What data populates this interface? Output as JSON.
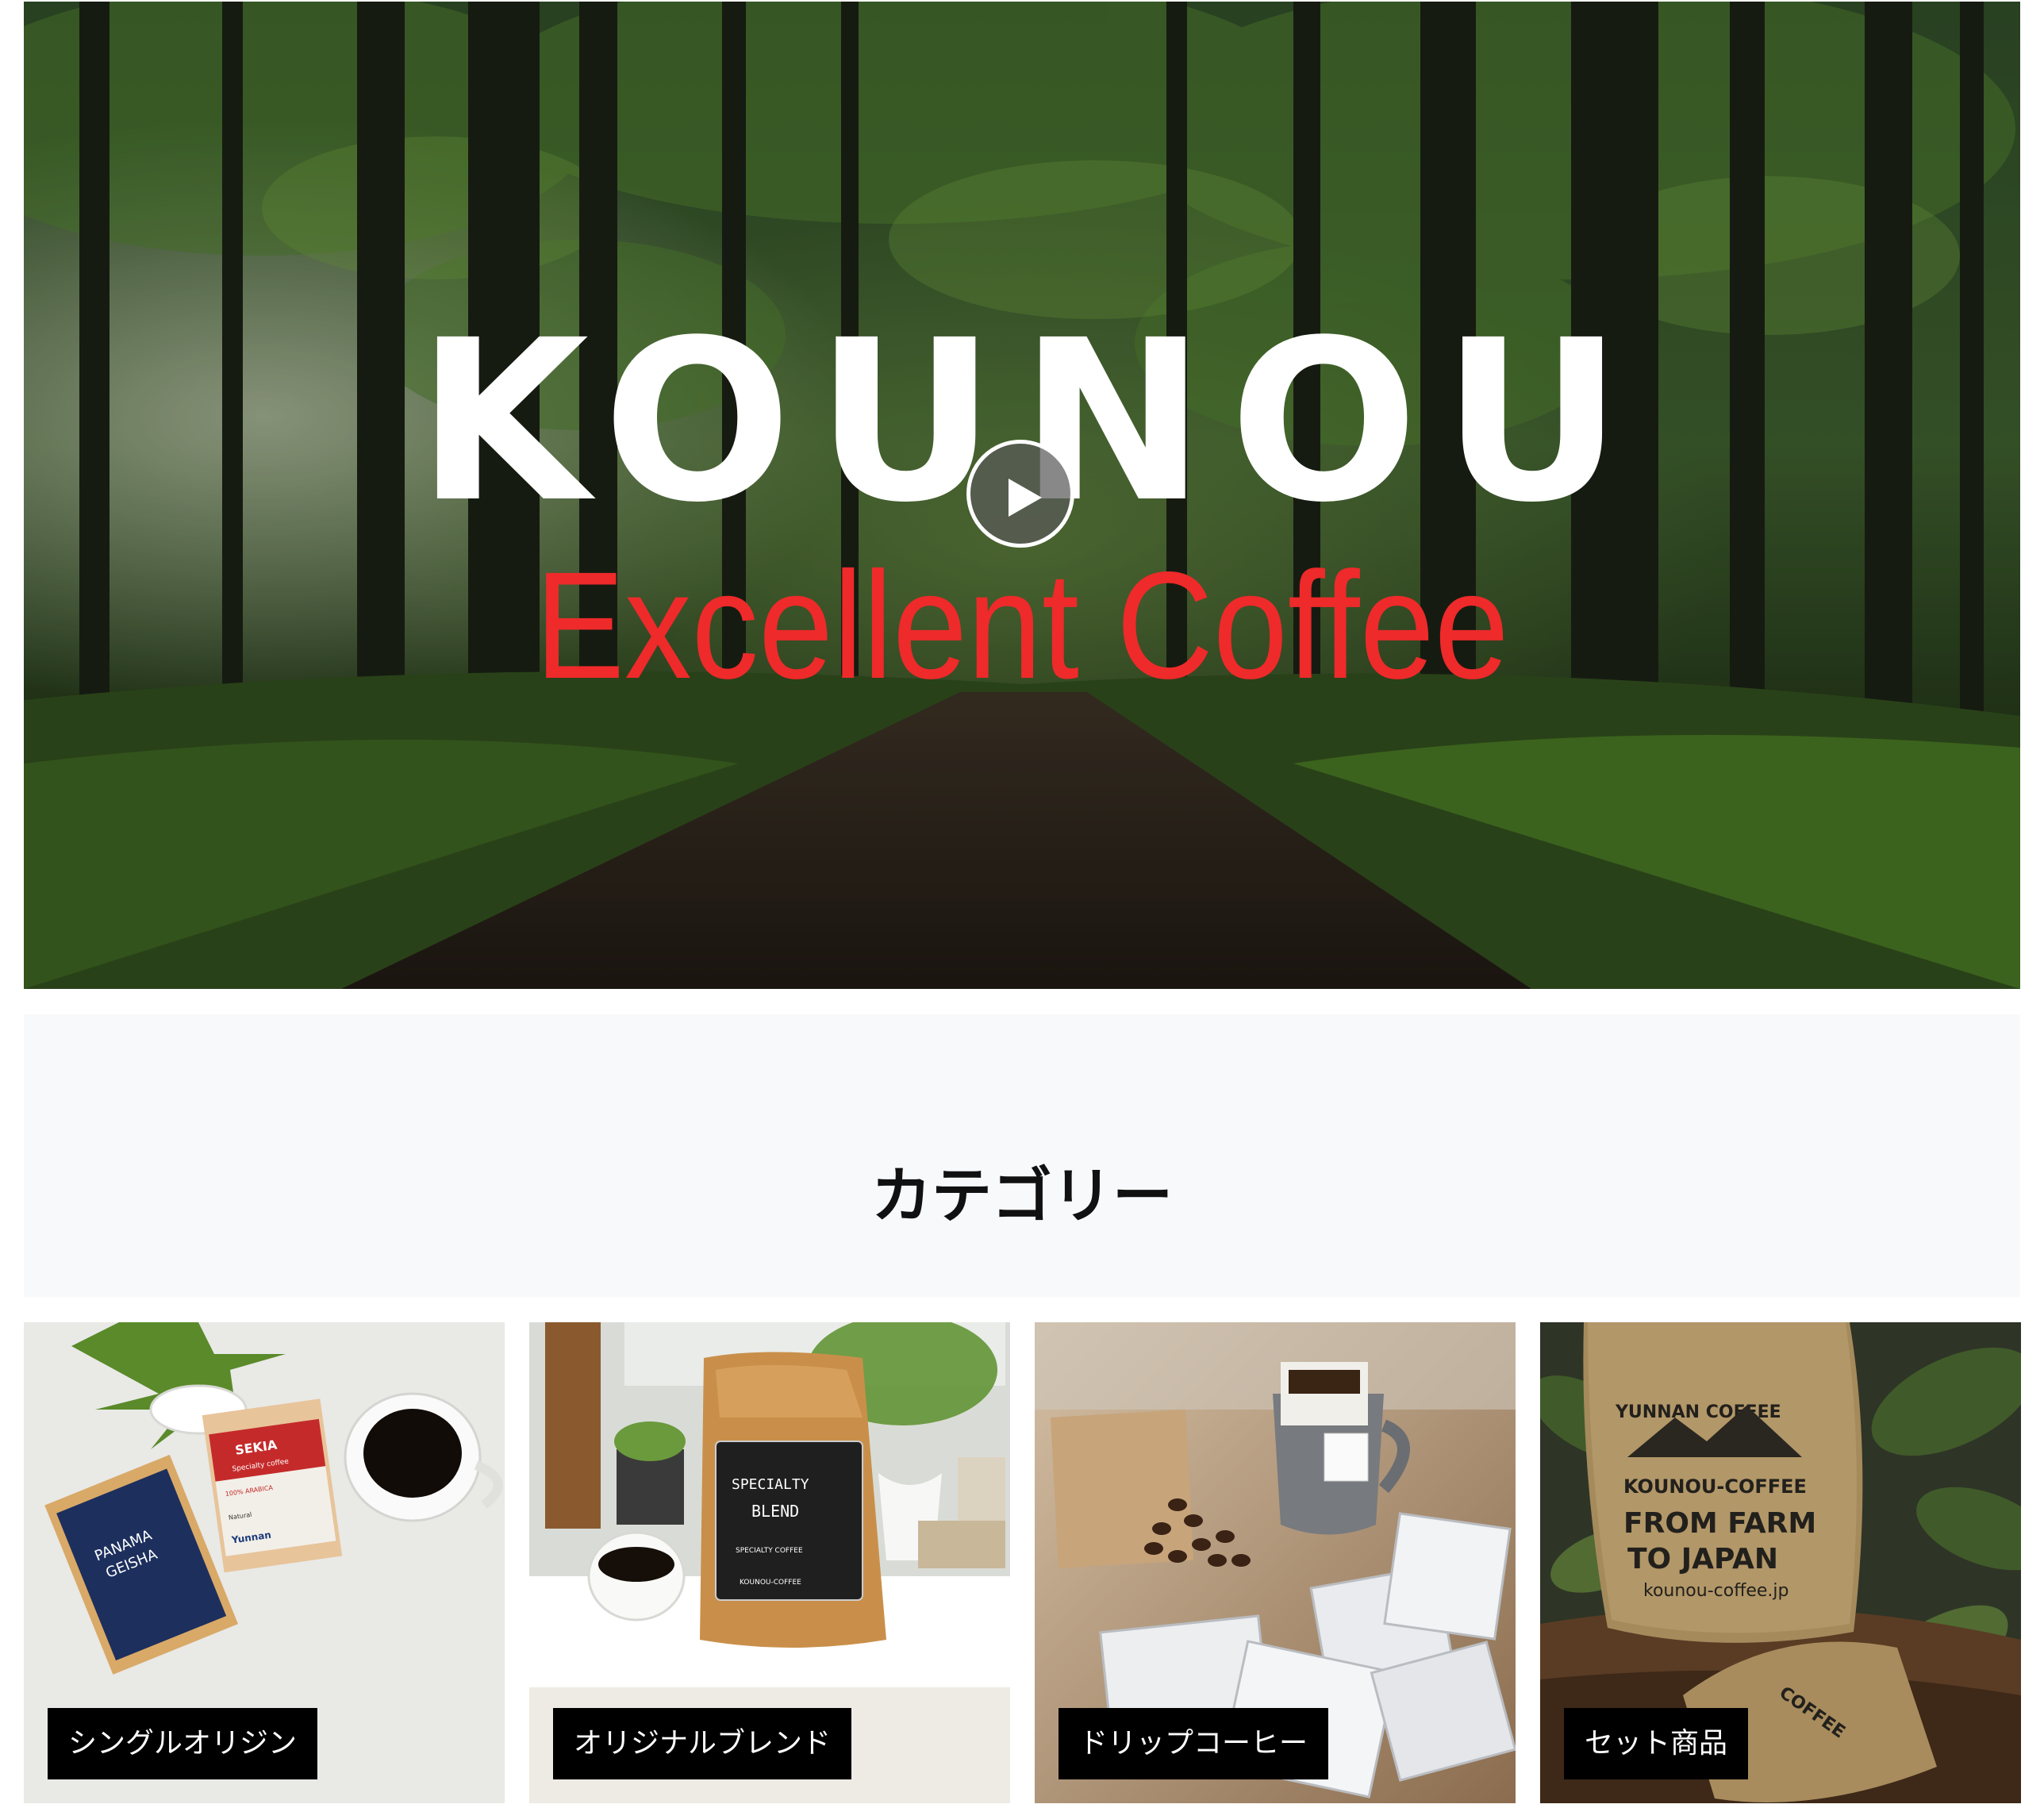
{
  "hero": {
    "title": "KOUNOU",
    "subtitle": "Excellent Coffee",
    "subtitle_color": "#ee2a2a",
    "play_icon": "play-icon"
  },
  "category_section": {
    "heading": "カテゴリー"
  },
  "categories": [
    {
      "label": "シングルオリジン",
      "image": "coffee-bags-and-cup-photo",
      "package_texts": [
        "PANAMA GEISHA",
        "SEKIA",
        "Specialty coffee",
        "100% ARABICA",
        "Natural",
        "Yunnan"
      ]
    },
    {
      "label": "オリジナルブレンド",
      "image": "specialty-blend-bag-photo",
      "package_texts": [
        "SPECIALTY",
        "BLEND",
        "SPECIALTY COFFEE",
        "KOUNOU-COFFEE"
      ]
    },
    {
      "label": "ドリップコーヒー",
      "image": "drip-bag-coffee-photo",
      "package_texts": []
    },
    {
      "label": "セット商品",
      "image": "burlap-coffee-sack-photo",
      "package_texts": [
        "YUNNAN COFFEE",
        "KOUNOU-COFFEE",
        "FROM FARM",
        "TO JAPAN",
        "kounou-coffee.jp",
        "COFFEE"
      ]
    }
  ],
  "colors": {
    "label_bg": "#000000",
    "section_bg": "#f8f9fb"
  }
}
